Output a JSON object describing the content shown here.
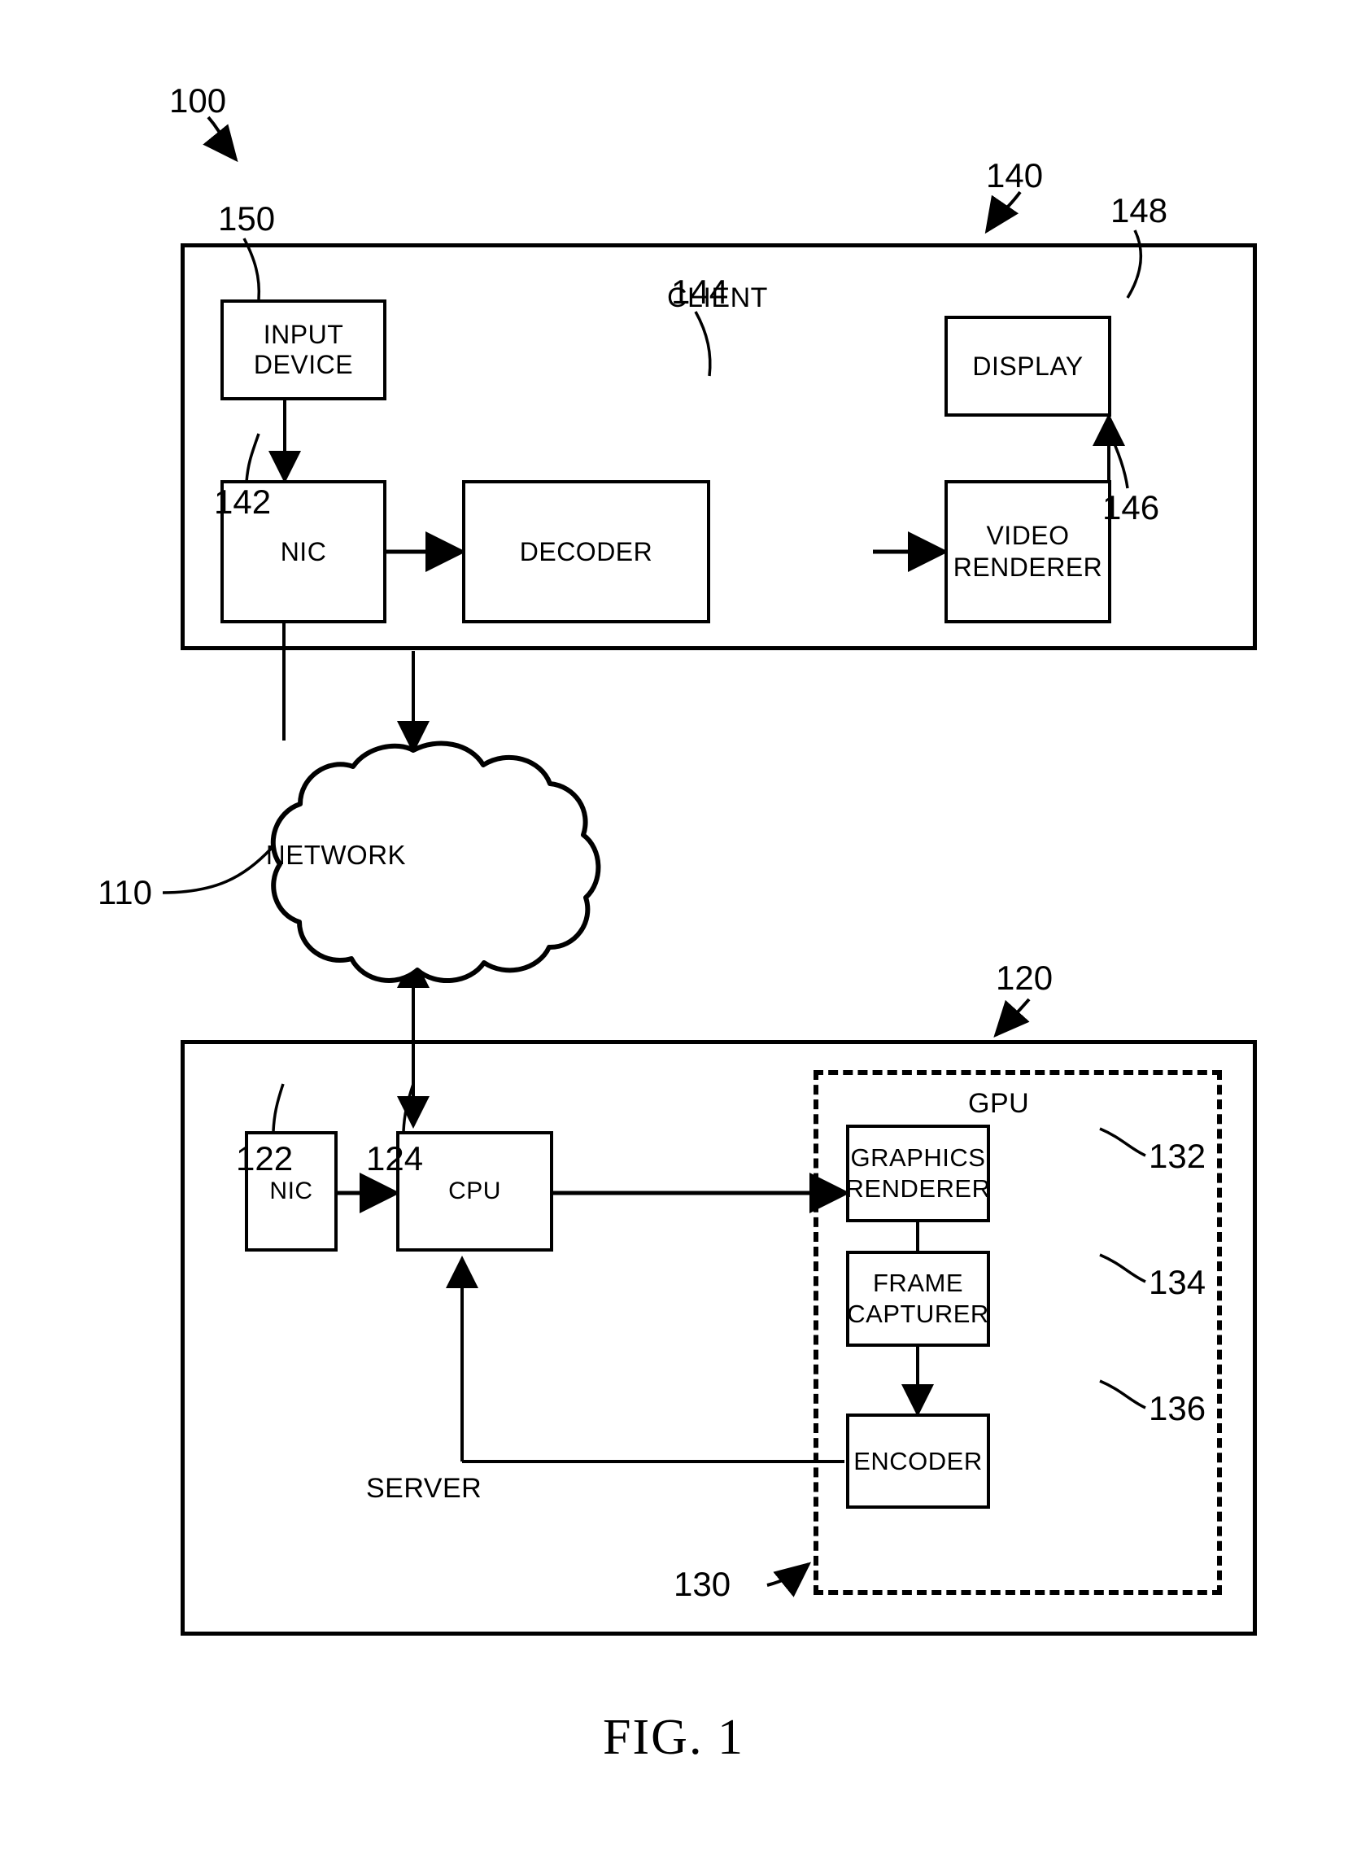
{
  "figure": {
    "caption": "FIG. 1",
    "system_ref": "100"
  },
  "client": {
    "title": "CLIENT",
    "ref": "140",
    "blocks": [
      {
        "label": "INPUT DEVICE",
        "ref": "150"
      },
      {
        "label": "NIC",
        "ref": "142"
      },
      {
        "label": "DECODER",
        "ref": "144"
      },
      {
        "label": "VIDEO RENDERER",
        "line1": "VIDEO",
        "line2": "RENDERER",
        "ref": "146"
      },
      {
        "label": "DISPLAY",
        "ref": "148"
      }
    ]
  },
  "network": {
    "label": "NETWORK",
    "ref": "110"
  },
  "server": {
    "title": "SERVER",
    "ref": "120",
    "blocks": [
      {
        "label": "NIC",
        "ref": "122"
      },
      {
        "label": "CPU",
        "ref": "124"
      }
    ],
    "gpu": {
      "title": "GPU",
      "ref": "130",
      "blocks": [
        {
          "label": "GRAPHICS RENDERER",
          "line1": "GRAPHICS",
          "line2": "RENDERER",
          "ref": "132"
        },
        {
          "label": "FRAME CAPTURER",
          "line1": "FRAME",
          "line2": "CAPTURER",
          "ref": "134"
        },
        {
          "label": "ENCODER",
          "ref": "136"
        }
      ]
    }
  },
  "colors": {
    "stroke": "#000000",
    "background": "#ffffff"
  }
}
